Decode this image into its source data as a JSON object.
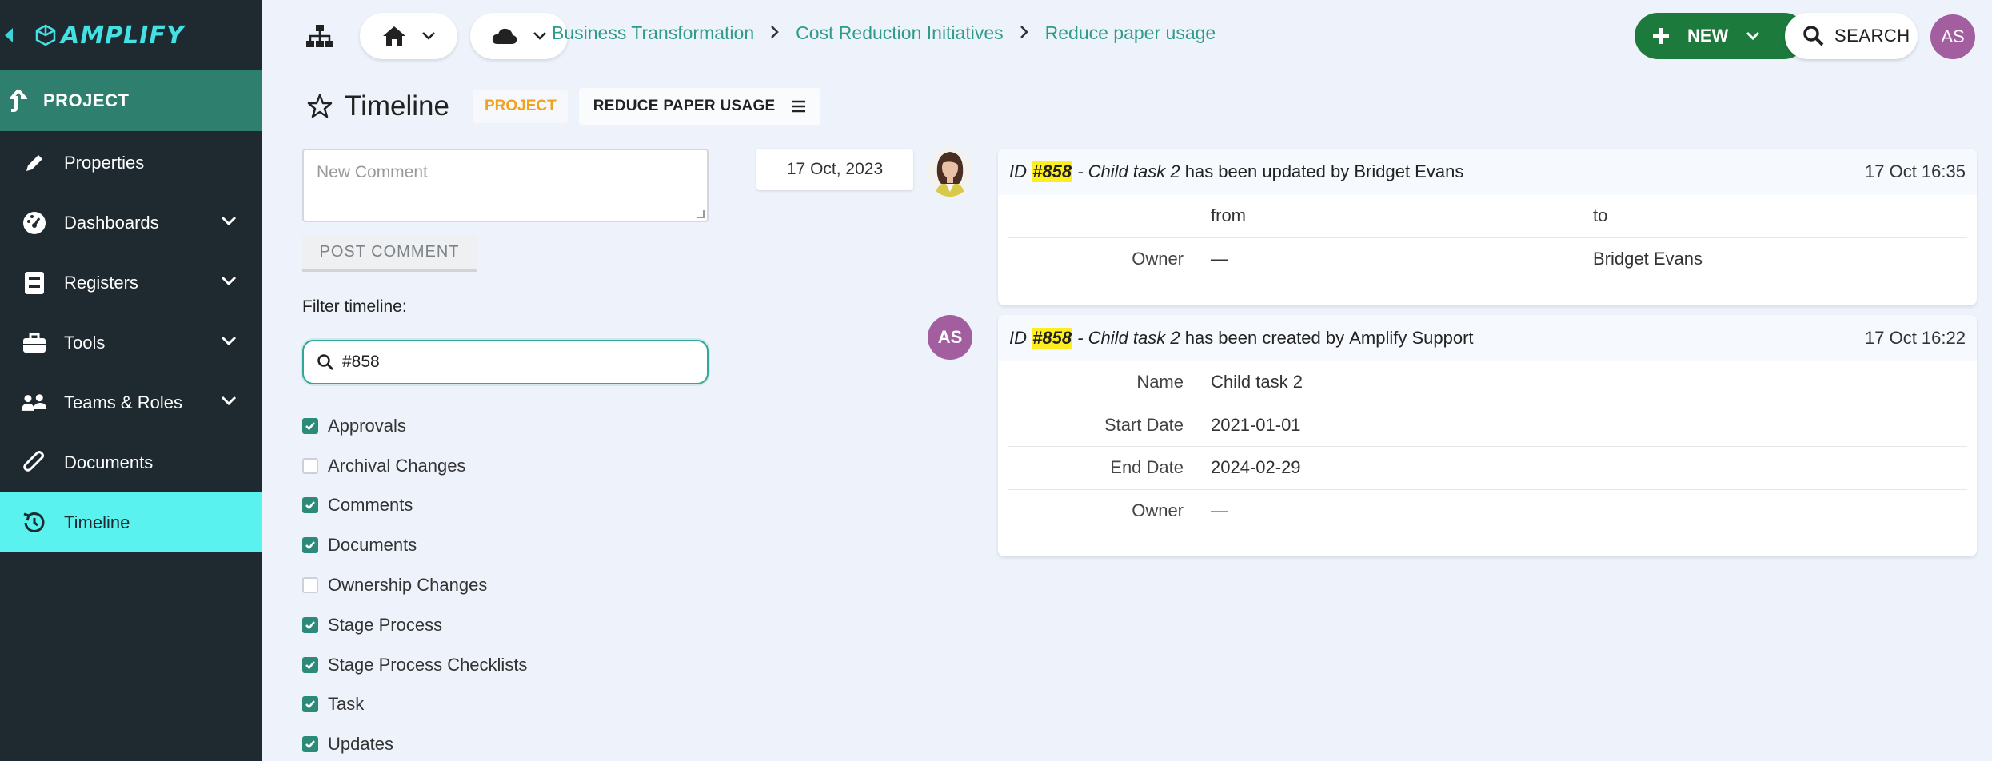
{
  "app": {
    "brand": "AMPLIFY",
    "user_initials": "AS"
  },
  "sidebar": {
    "project_label": "PROJECT",
    "items": [
      {
        "label": "Properties",
        "icon": "pencil-icon",
        "expandable": false
      },
      {
        "label": "Dashboards",
        "icon": "gauge-icon",
        "expandable": true
      },
      {
        "label": "Registers",
        "icon": "register-icon",
        "expandable": true
      },
      {
        "label": "Tools",
        "icon": "toolbox-icon",
        "expandable": true
      },
      {
        "label": "Teams & Roles",
        "icon": "users-icon",
        "expandable": true
      },
      {
        "label": "Documents",
        "icon": "paperclip-icon",
        "expandable": false
      },
      {
        "label": "Timeline",
        "icon": "history-icon",
        "expandable": false,
        "active": true
      }
    ]
  },
  "topbar": {
    "breadcrumb": [
      "Business Transformation",
      "Cost Reduction Initiatives",
      "Reduce paper usage"
    ],
    "new_label": "NEW",
    "search_label": "SEARCH"
  },
  "page": {
    "title": "Timeline",
    "badge_type": "PROJECT",
    "badge_item": "REDUCE PAPER USAGE"
  },
  "comment": {
    "placeholder": "New Comment",
    "post_label": "POST COMMENT"
  },
  "filter": {
    "label": "Filter timeline:",
    "value": "#858",
    "options": [
      {
        "label": "Approvals",
        "checked": true
      },
      {
        "label": "Archival Changes",
        "checked": false
      },
      {
        "label": "Comments",
        "checked": true
      },
      {
        "label": "Documents",
        "checked": true
      },
      {
        "label": "Ownership Changes",
        "checked": false
      },
      {
        "label": "Stage Process",
        "checked": true
      },
      {
        "label": "Stage Process Checklists",
        "checked": true
      },
      {
        "label": "Task",
        "checked": true
      },
      {
        "label": "Updates",
        "checked": true
      }
    ]
  },
  "timeline": {
    "date": "17 Oct, 2023",
    "entries": [
      {
        "id_prefix": "ID",
        "id": "#858",
        "item": "- Child task 2",
        "action": "has been updated by",
        "user": "Bridget Evans",
        "time": "17 Oct 16:35",
        "header_from": "from",
        "header_to": "to",
        "rows": [
          {
            "key": "Owner",
            "from": "—",
            "to": "Bridget Evans"
          }
        ]
      },
      {
        "id_prefix": "ID",
        "id": "#858",
        "item": "- Child task 2",
        "action": "has been created by",
        "user": "Amplify Support",
        "user_initials": "AS",
        "time": "17 Oct 16:22",
        "rows": [
          {
            "key": "Name",
            "value": "Child task 2"
          },
          {
            "key": "Start Date",
            "value": "2021-01-01"
          },
          {
            "key": "End Date",
            "value": "2024-02-29"
          },
          {
            "key": "Owner",
            "value": "—"
          }
        ]
      }
    ]
  },
  "colors": {
    "sidebar_bg": "#1f2a30",
    "accent_teal": "#59f2ee",
    "project_green": "#2f7f6e",
    "new_button": "#1c7b3c",
    "highlight": "#ffee1f",
    "avatar": "#a35ea0",
    "badge_orange": "#f0a11e"
  }
}
